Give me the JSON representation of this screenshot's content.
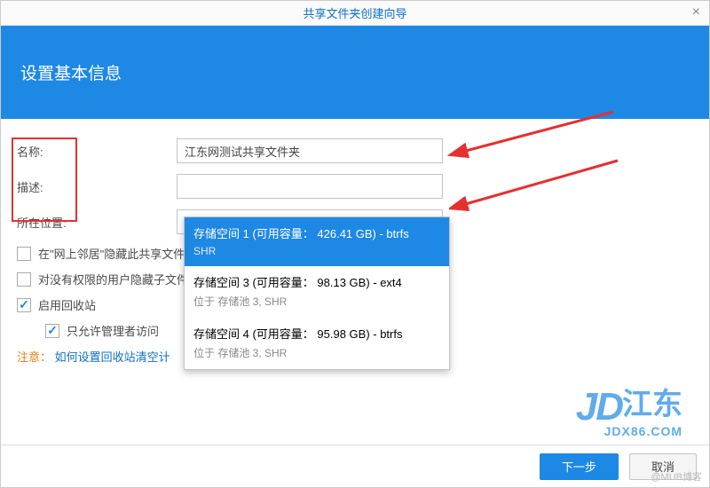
{
  "title": "共享文件夹创建向导",
  "banner": "设置基本信息",
  "labels": {
    "name": "名称:",
    "desc": "描述:",
    "location": "所在位置:"
  },
  "fields": {
    "name": "江东网测试共享文件夹",
    "desc": ""
  },
  "select": {
    "text": "存储空间 1 (可用容量： 426.41 GB) - btrfs"
  },
  "options": [
    {
      "title": "存储空间 1 (可用容量： 426.41 GB) - btrfs",
      "sub": "SHR",
      "selected": true
    },
    {
      "title": "存储空间 3 (可用容量： 98.13 GB) - ext4",
      "sub": "位于 存储池 3, SHR",
      "selected": false
    },
    {
      "title": "存储空间 4 (可用容量： 95.98 GB) - btrfs",
      "sub": "位于 存储池 3, SHR",
      "selected": false
    }
  ],
  "checks": {
    "hide_network": "在\"网上邻居\"隐藏此共享文件",
    "hide_noperm": "对没有权限的用户隐藏子文件",
    "recycle": "启用回收站",
    "admin_only": "只允许管理者访问"
  },
  "note": {
    "pre": "注意：",
    "link": "如何设置回收站清空计"
  },
  "buttons": {
    "next": "下一步",
    "cancel": "取消"
  },
  "wm": {
    "jd": "JD",
    "cn": "江东",
    "url": "JDX86.COM",
    "small": "@MUB博客"
  }
}
